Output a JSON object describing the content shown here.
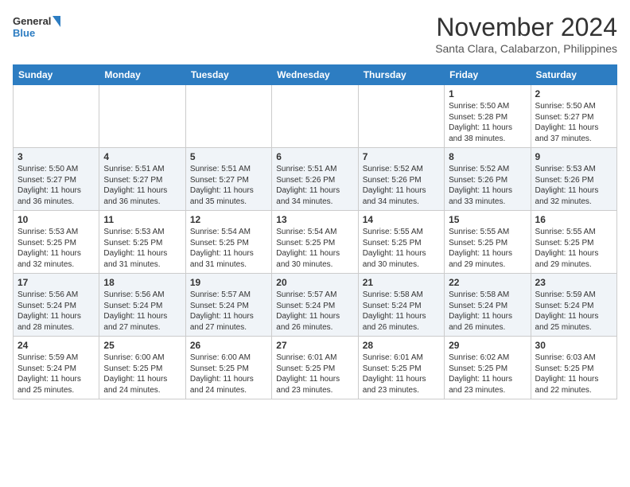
{
  "logo": {
    "line1": "General",
    "line2": "Blue"
  },
  "header": {
    "month": "November 2024",
    "location": "Santa Clara, Calabarzon, Philippines"
  },
  "weekdays": [
    "Sunday",
    "Monday",
    "Tuesday",
    "Wednesday",
    "Thursday",
    "Friday",
    "Saturday"
  ],
  "weeks": [
    [
      {
        "day": "",
        "info": ""
      },
      {
        "day": "",
        "info": ""
      },
      {
        "day": "",
        "info": ""
      },
      {
        "day": "",
        "info": ""
      },
      {
        "day": "",
        "info": ""
      },
      {
        "day": "1",
        "info": "Sunrise: 5:50 AM\nSunset: 5:28 PM\nDaylight: 11 hours\nand 38 minutes."
      },
      {
        "day": "2",
        "info": "Sunrise: 5:50 AM\nSunset: 5:27 PM\nDaylight: 11 hours\nand 37 minutes."
      }
    ],
    [
      {
        "day": "3",
        "info": "Sunrise: 5:50 AM\nSunset: 5:27 PM\nDaylight: 11 hours\nand 36 minutes."
      },
      {
        "day": "4",
        "info": "Sunrise: 5:51 AM\nSunset: 5:27 PM\nDaylight: 11 hours\nand 36 minutes."
      },
      {
        "day": "5",
        "info": "Sunrise: 5:51 AM\nSunset: 5:27 PM\nDaylight: 11 hours\nand 35 minutes."
      },
      {
        "day": "6",
        "info": "Sunrise: 5:51 AM\nSunset: 5:26 PM\nDaylight: 11 hours\nand 34 minutes."
      },
      {
        "day": "7",
        "info": "Sunrise: 5:52 AM\nSunset: 5:26 PM\nDaylight: 11 hours\nand 34 minutes."
      },
      {
        "day": "8",
        "info": "Sunrise: 5:52 AM\nSunset: 5:26 PM\nDaylight: 11 hours\nand 33 minutes."
      },
      {
        "day": "9",
        "info": "Sunrise: 5:53 AM\nSunset: 5:26 PM\nDaylight: 11 hours\nand 32 minutes."
      }
    ],
    [
      {
        "day": "10",
        "info": "Sunrise: 5:53 AM\nSunset: 5:25 PM\nDaylight: 11 hours\nand 32 minutes."
      },
      {
        "day": "11",
        "info": "Sunrise: 5:53 AM\nSunset: 5:25 PM\nDaylight: 11 hours\nand 31 minutes."
      },
      {
        "day": "12",
        "info": "Sunrise: 5:54 AM\nSunset: 5:25 PM\nDaylight: 11 hours\nand 31 minutes."
      },
      {
        "day": "13",
        "info": "Sunrise: 5:54 AM\nSunset: 5:25 PM\nDaylight: 11 hours\nand 30 minutes."
      },
      {
        "day": "14",
        "info": "Sunrise: 5:55 AM\nSunset: 5:25 PM\nDaylight: 11 hours\nand 30 minutes."
      },
      {
        "day": "15",
        "info": "Sunrise: 5:55 AM\nSunset: 5:25 PM\nDaylight: 11 hours\nand 29 minutes."
      },
      {
        "day": "16",
        "info": "Sunrise: 5:55 AM\nSunset: 5:25 PM\nDaylight: 11 hours\nand 29 minutes."
      }
    ],
    [
      {
        "day": "17",
        "info": "Sunrise: 5:56 AM\nSunset: 5:24 PM\nDaylight: 11 hours\nand 28 minutes."
      },
      {
        "day": "18",
        "info": "Sunrise: 5:56 AM\nSunset: 5:24 PM\nDaylight: 11 hours\nand 27 minutes."
      },
      {
        "day": "19",
        "info": "Sunrise: 5:57 AM\nSunset: 5:24 PM\nDaylight: 11 hours\nand 27 minutes."
      },
      {
        "day": "20",
        "info": "Sunrise: 5:57 AM\nSunset: 5:24 PM\nDaylight: 11 hours\nand 26 minutes."
      },
      {
        "day": "21",
        "info": "Sunrise: 5:58 AM\nSunset: 5:24 PM\nDaylight: 11 hours\nand 26 minutes."
      },
      {
        "day": "22",
        "info": "Sunrise: 5:58 AM\nSunset: 5:24 PM\nDaylight: 11 hours\nand 26 minutes."
      },
      {
        "day": "23",
        "info": "Sunrise: 5:59 AM\nSunset: 5:24 PM\nDaylight: 11 hours\nand 25 minutes."
      }
    ],
    [
      {
        "day": "24",
        "info": "Sunrise: 5:59 AM\nSunset: 5:24 PM\nDaylight: 11 hours\nand 25 minutes."
      },
      {
        "day": "25",
        "info": "Sunrise: 6:00 AM\nSunset: 5:25 PM\nDaylight: 11 hours\nand 24 minutes."
      },
      {
        "day": "26",
        "info": "Sunrise: 6:00 AM\nSunset: 5:25 PM\nDaylight: 11 hours\nand 24 minutes."
      },
      {
        "day": "27",
        "info": "Sunrise: 6:01 AM\nSunset: 5:25 PM\nDaylight: 11 hours\nand 23 minutes."
      },
      {
        "day": "28",
        "info": "Sunrise: 6:01 AM\nSunset: 5:25 PM\nDaylight: 11 hours\nand 23 minutes."
      },
      {
        "day": "29",
        "info": "Sunrise: 6:02 AM\nSunset: 5:25 PM\nDaylight: 11 hours\nand 23 minutes."
      },
      {
        "day": "30",
        "info": "Sunrise: 6:03 AM\nSunset: 5:25 PM\nDaylight: 11 hours\nand 22 minutes."
      }
    ]
  ]
}
